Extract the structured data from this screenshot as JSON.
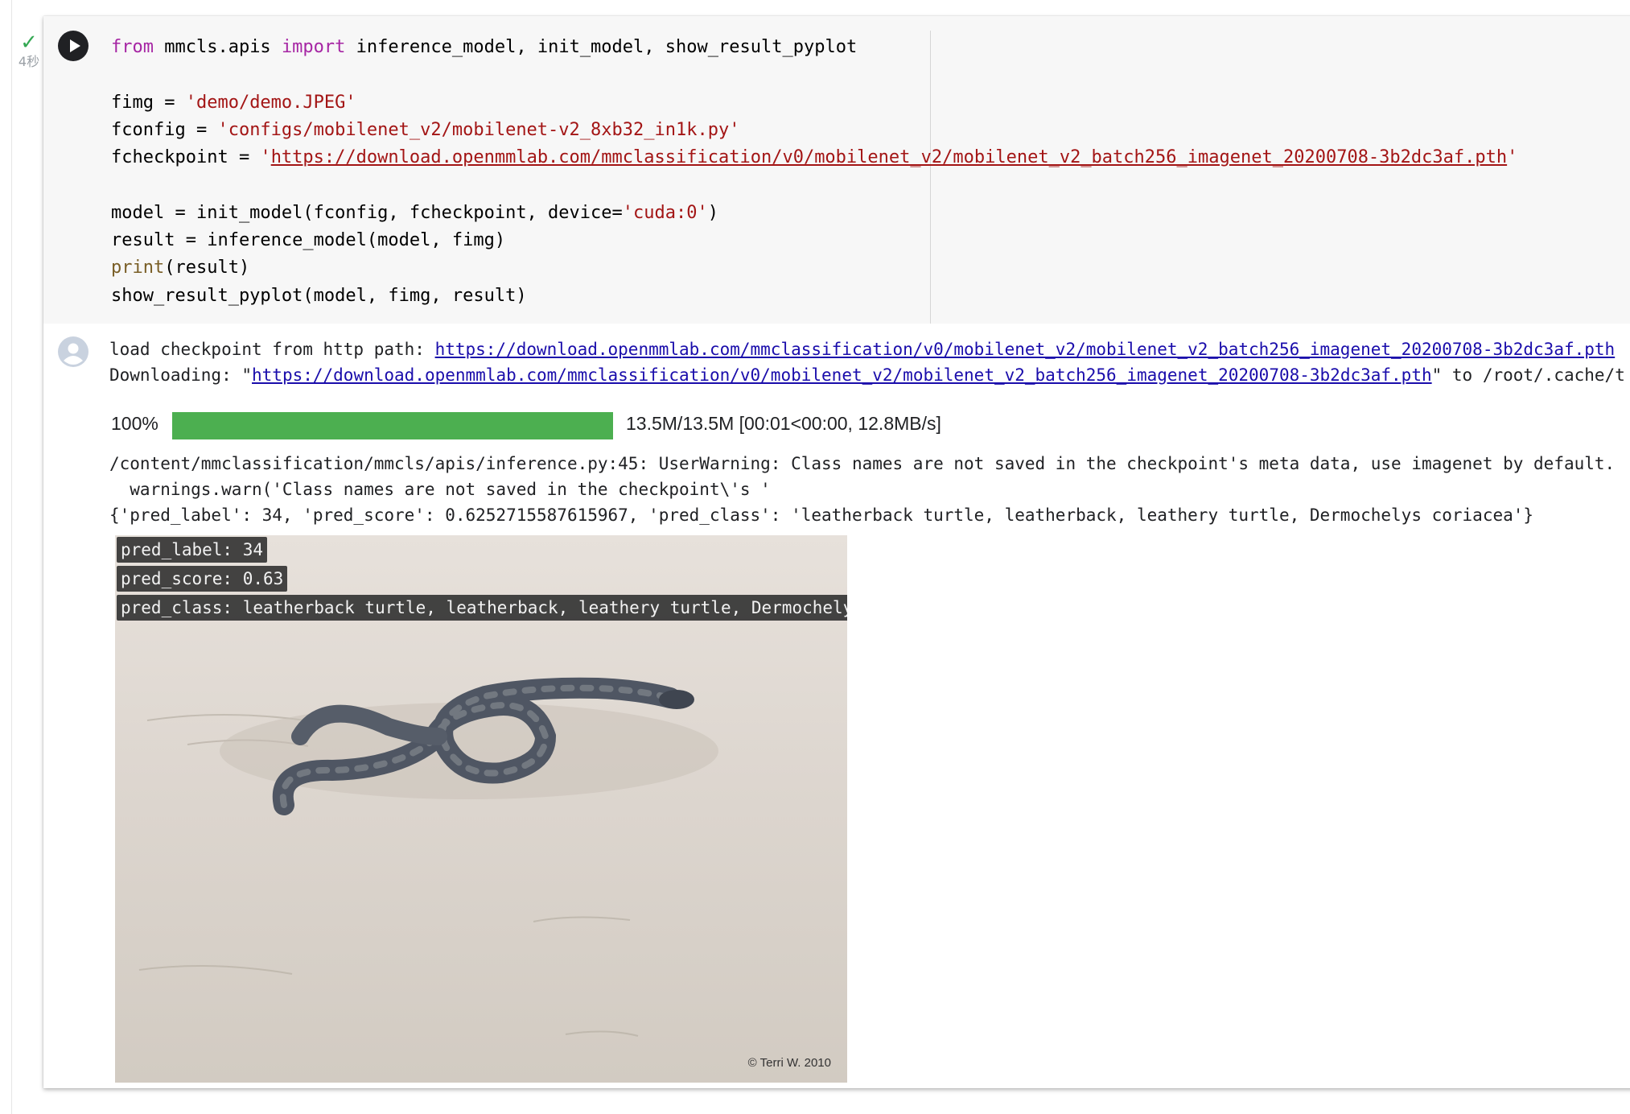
{
  "status": {
    "check_icon": "checkmark-icon",
    "elapsed": "4秒"
  },
  "code": {
    "l1_kw": "from",
    "l1_mod": " mmcls.apis ",
    "l1_kw2": "import",
    "l1_rest": " inference_model, init_model, show_result_pyplot",
    "l3_a": "fimg = ",
    "l3_str": "'demo/demo.JPEG'",
    "l4_a": "fconfig = ",
    "l4_str": "'configs/mobilenet_v2/mobilenet-v2_8xb32_in1k.py'",
    "l5_a": "fcheckpoint = ",
    "l5_q1": "'",
    "l5_url": "https://download.openmmlab.com/mmclassification/v0/mobilenet_v2/mobilenet_v2_batch256_imagenet_20200708-3b2dc3af.pth",
    "l5_q2": "'",
    "l7_a": "model = init_model(fconfig, fcheckpoint, device=",
    "l7_str": "'cuda:0'",
    "l7_b": ")",
    "l8": "result = inference_model(model, fimg)",
    "l9_fn": "print",
    "l9_rest": "(result)",
    "l10": "show_result_pyplot(model, fimg, result)"
  },
  "output": {
    "line1_text": "load checkpoint from http path: ",
    "line1_link": "https://download.openmmlab.com/mmclassification/v0/mobilenet_v2/mobilenet_v2_batch256_imagenet_20200708-3b2dc3af.pth",
    "line2_text": "Downloading: \"",
    "line2_link": "https://download.openmmlab.com/mmclassification/v0/mobilenet_v2/mobilenet_v2_batch256_imagenet_20200708-3b2dc3af.pth",
    "line2_tail": "\" to /root/.cache/t",
    "progress": {
      "percent_label": "100%",
      "fraction": 1.0,
      "info": "13.5M/13.5M [00:01<00:00, 12.8MB/s]",
      "color": "#4caf50"
    },
    "warning1": "/content/mmclassification/mmcls/apis/inference.py:45: UserWarning: Class names are not saved in the checkpoint's meta data, use imagenet by default.",
    "warning2": "  warnings.warn('Class names are not saved in the checkpoint\\'s '",
    "result_line": "{'pred_label': 34, 'pred_score': 0.6252715587615967, 'pred_class': 'leatherback turtle, leatherback, leathery turtle, Dermochelys coriacea'}"
  },
  "image": {
    "labels": [
      "pred_label: 34",
      "pred_score: 0.63",
      "pred_class: leatherback turtle, leatherback, leathery turtle, Dermochelys coriacea"
    ],
    "credit": "© Terri W. 2010"
  },
  "icons": {
    "run": "play-icon",
    "output": "avatar-icon"
  }
}
